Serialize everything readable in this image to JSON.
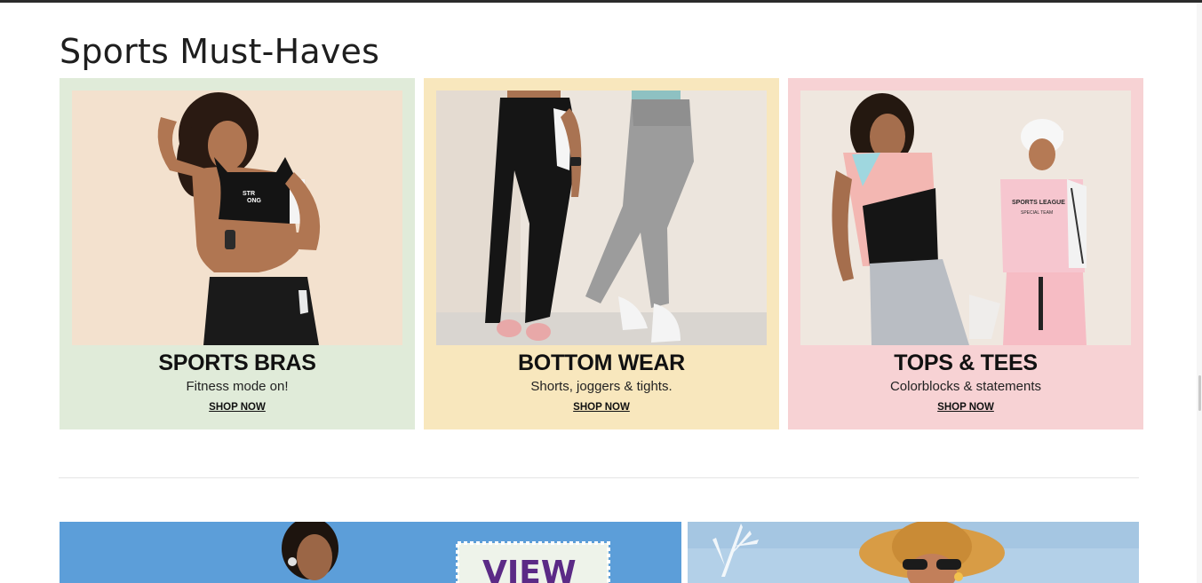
{
  "section": {
    "title": "Sports Must-Haves"
  },
  "cards": [
    {
      "title": "SPORTS BRAS",
      "subtitle": "Fitness mode on!",
      "cta": "SHOP NOW",
      "bg": "#e0ebd9"
    },
    {
      "title": "BOTTOM WEAR",
      "subtitle": "Shorts,  joggers & tights.",
      "cta": "SHOP NOW",
      "bg": "#f8e7bd"
    },
    {
      "title": "TOPS & TEES",
      "subtitle": "Colorblocks & statements",
      "cta": "SHOP NOW",
      "bg": "#f7d2d4"
    }
  ],
  "banners": {
    "left": {
      "stamp_text": "VIEW"
    }
  },
  "colors": {
    "topbar": "#2b2b2b",
    "divider": "#e4e4e4",
    "stamp_text": "#5b2a86"
  }
}
